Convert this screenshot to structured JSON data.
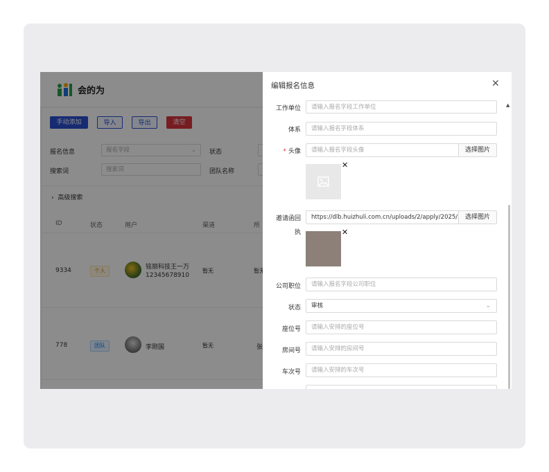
{
  "app": {
    "logo_text": "会的为",
    "buttons": {
      "manual_add": "手动添加",
      "import": "导入",
      "export": "导出",
      "clear": "清空"
    },
    "filters": {
      "reg_info_label": "报名信息",
      "reg_info_placeholder": "报名字段",
      "status_label": "状态",
      "keyword_label": "搜索词",
      "keyword_placeholder": "搜索词",
      "team_label": "团队名称"
    },
    "advanced_search": "高级搜索",
    "table": {
      "headers": [
        "ID",
        "状态",
        "用户",
        "渠道",
        "所"
      ],
      "rows": [
        {
          "id": "9334",
          "status": "个人",
          "name": "铭丽科技王一万",
          "phone": "12345678910",
          "channel": "暂无",
          "extra": "暂无"
        },
        {
          "id": "778",
          "status": "团队",
          "name": "李刚国",
          "phone": "",
          "channel": "暂无",
          "extra": "张"
        }
      ]
    }
  },
  "drawer": {
    "title": "编辑报名信息",
    "close_icon": "close-icon",
    "fields": {
      "work_unit": {
        "label": "工作单位",
        "placeholder": "请输入报名字段工作单位"
      },
      "system": {
        "label": "体系",
        "placeholder": "请输入报名字段体系"
      },
      "avatar": {
        "label": "头像",
        "placeholder": "请输入报名字段头像",
        "button": "选择图片"
      },
      "invitation": {
        "label_line1": "邀请函回",
        "label_line2": "执",
        "value": "https://dlb.huizhuli.com.cn/uploads/2/apply/2025/",
        "button": "选择图片"
      },
      "position": {
        "label": "公司职位",
        "placeholder": "请输入报名字段公司职位"
      },
      "status": {
        "label": "状态",
        "value": "审核"
      },
      "seat": {
        "label": "座位号",
        "placeholder": "请输入安排的座位号"
      },
      "room": {
        "label": "房间号",
        "placeholder": "请输入安排的房间号"
      },
      "train": {
        "label": "车次号",
        "placeholder": "请输入安排的车次号"
      }
    },
    "remove_glyph": "✕"
  }
}
